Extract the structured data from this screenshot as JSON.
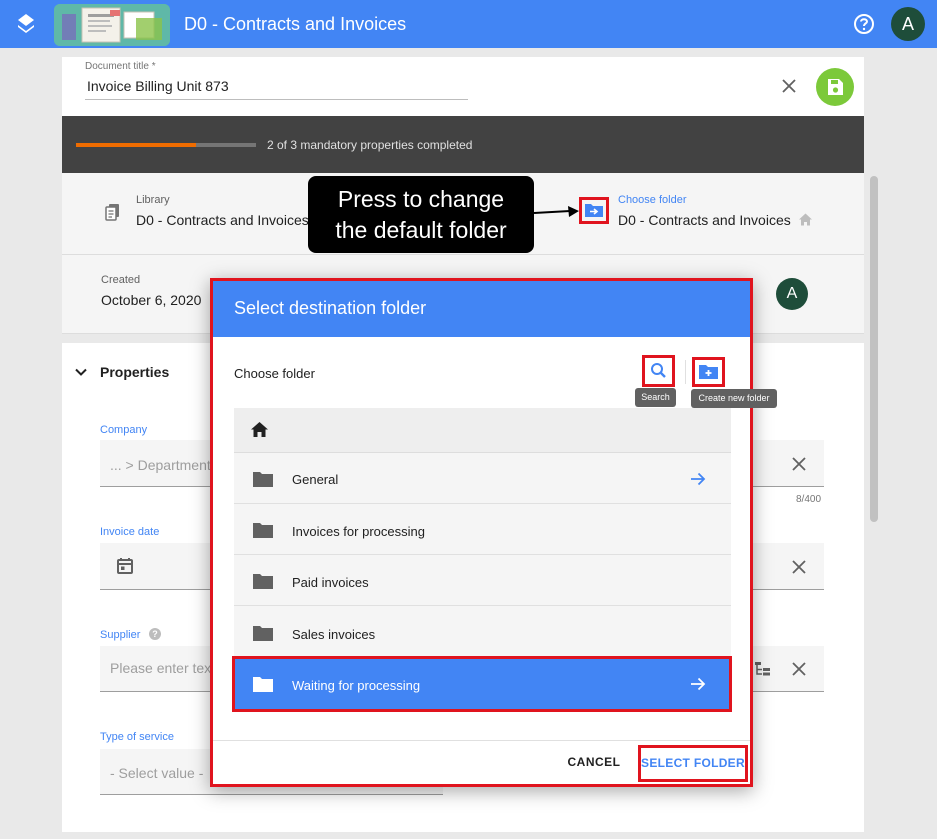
{
  "app": {
    "title": "D0 - Contracts and Invoices",
    "user_initial": "A",
    "icons": {
      "logo": "stack-logo-icon",
      "help": "help-circle-icon"
    },
    "colors": {
      "primary": "#4285f4",
      "save": "#7cc93a",
      "progress": "#ef6c00",
      "highlight": "#e0141e"
    }
  },
  "document": {
    "title_label": "Document title *",
    "title_value": "Invoice Billing Unit 873",
    "progress": {
      "completed": 2,
      "total": 3,
      "text": "2 of 3 mandatory properties completed"
    },
    "library": {
      "label": "Library",
      "value": "D0 - Contracts and Invoices"
    },
    "folder": {
      "label": "Choose folder",
      "value": "D0 - Contracts and Invoices"
    },
    "created": {
      "label": "Created",
      "value": "October 6, 2020"
    },
    "callout": {
      "line1": "Press to change",
      "line2": "the default folder"
    }
  },
  "properties": {
    "title": "Properties",
    "company": {
      "label": "Company",
      "placeholder": "... >  Department",
      "counter": "8/400"
    },
    "invoice_date": {
      "label": "Invoice date"
    },
    "supplier": {
      "label": "Supplier",
      "placeholder": "Please enter tex"
    },
    "service": {
      "label": "Type of service",
      "placeholder": "- Select value -"
    }
  },
  "dialog": {
    "title": "Select destination folder",
    "heading": "Choose folder",
    "search_tooltip": "Search",
    "create_tooltip": "Create new folder",
    "folders": [
      {
        "name": "General",
        "arrow": true,
        "selected": false
      },
      {
        "name": "Invoices for processing",
        "arrow": false,
        "selected": false
      },
      {
        "name": "Paid invoices",
        "arrow": false,
        "selected": false
      },
      {
        "name": "Sales invoices",
        "arrow": false,
        "selected": false
      },
      {
        "name": "Waiting for processing",
        "arrow": true,
        "selected": true
      }
    ],
    "cancel_label": "CANCEL",
    "select_label": "SELECT FOLDER"
  }
}
